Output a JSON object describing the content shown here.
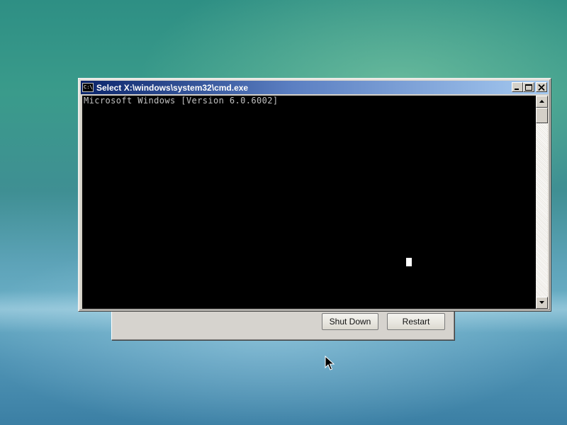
{
  "desktop": {
    "colors": {
      "wallpaper_top": "#2e8f84",
      "wallpaper_bottom": "#3b7fa4"
    }
  },
  "background_dialog": {
    "buttons": {
      "shutdown_label": "Shut Down",
      "restart_label": "Restart"
    }
  },
  "cmd_window": {
    "title": "Select X:\\windows\\system32\\cmd.exe",
    "icon": "console-app-icon",
    "icon_glyph": "C:\\",
    "controls": [
      "minimize-icon",
      "maximize-icon",
      "close-icon"
    ],
    "console": {
      "lines": [
        "Microsoft Windows [Version 6.0.6002]"
      ],
      "text_color": "#c0c0c0",
      "background_color": "#000000"
    },
    "titlebar_colors": {
      "start": "#0a246a",
      "end": "#a6caf0"
    }
  },
  "mouse": {
    "icon": "mouse-pointer-icon"
  }
}
